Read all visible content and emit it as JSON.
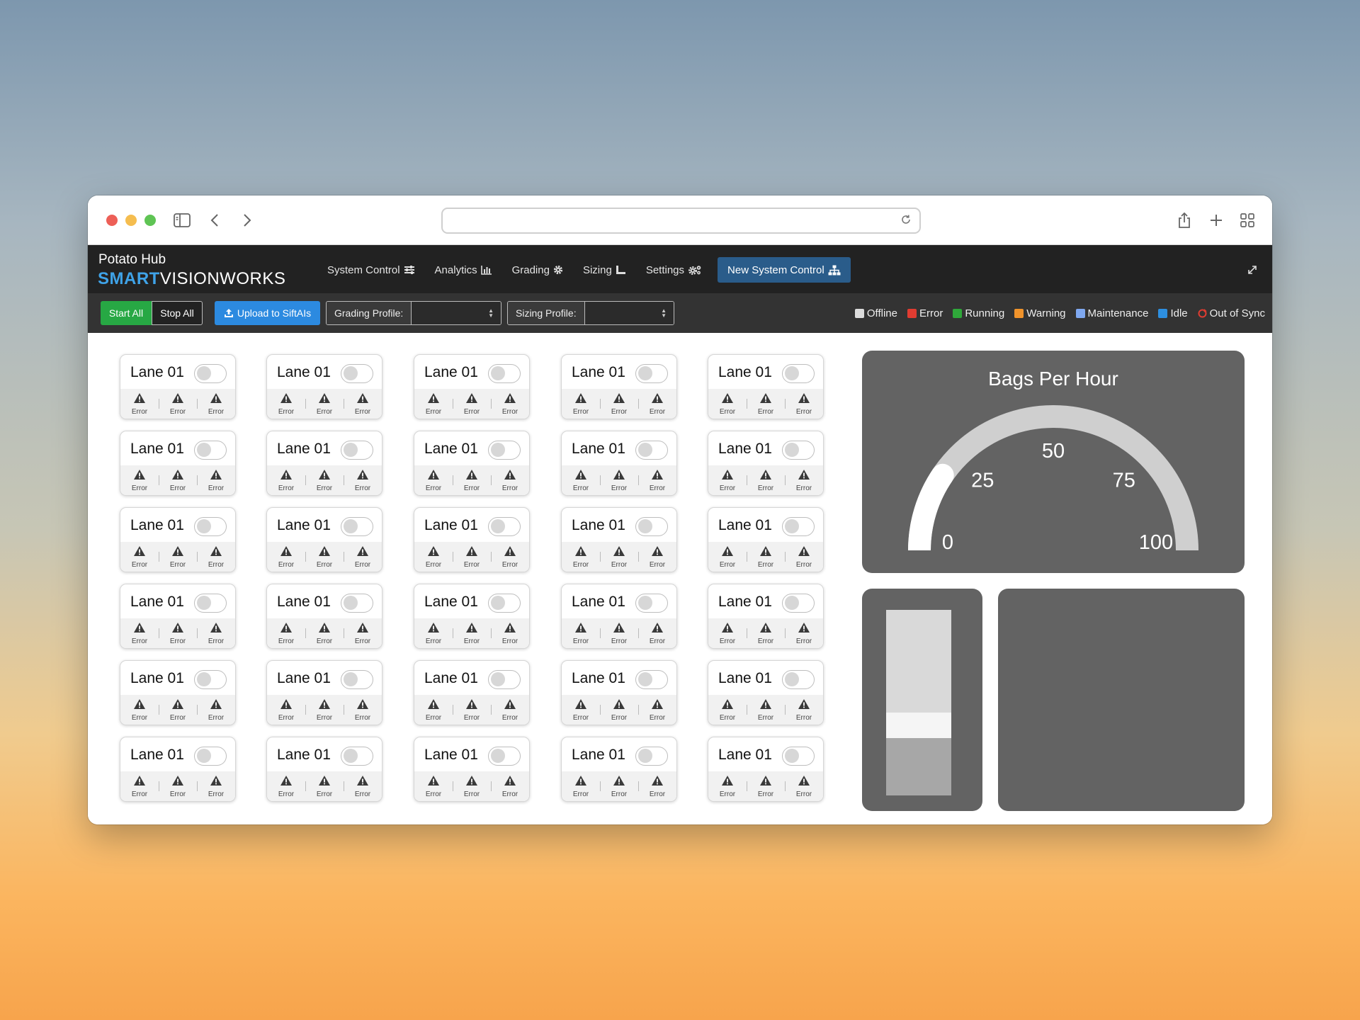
{
  "browser": {
    "address_value": ""
  },
  "app": {
    "brand_top": "Potato Hub",
    "brand_smart": "SMART",
    "brand_rest": "VISIONWORKS",
    "nav": [
      {
        "label": "System Control",
        "icon": "sliders-icon"
      },
      {
        "label": "Analytics",
        "icon": "bar-chart-icon"
      },
      {
        "label": "Grading",
        "icon": "gear-icon"
      },
      {
        "label": "Sizing",
        "icon": "ruler-icon"
      },
      {
        "label": "Settings",
        "icon": "gears-icon"
      },
      {
        "label": "New System Control",
        "icon": "sitemap-icon",
        "active": true
      }
    ]
  },
  "toolbar": {
    "start_all": "Start All",
    "stop_all": "Stop All",
    "upload": "Upload to SiftAIs",
    "grading_profile_label": "Grading Profile:",
    "grading_profile_value": "",
    "sizing_profile_label": "Sizing Profile:",
    "sizing_profile_value": ""
  },
  "legend": [
    {
      "label": "Offline",
      "color": "#dcdcdc"
    },
    {
      "label": "Error",
      "color": "#e03c31"
    },
    {
      "label": "Running",
      "color": "#2fa83a"
    },
    {
      "label": "Warning",
      "color": "#f0932b"
    },
    {
      "label": "Maintenance",
      "color": "#7fa8f0"
    },
    {
      "label": "Idle",
      "color": "#2d8fe0"
    },
    {
      "label": "Out of Sync",
      "color": "#e03c31",
      "icon": "sync-icon"
    }
  ],
  "lanes": {
    "name": "Lane 01",
    "status_label": "Error",
    "status_icon": "warning-icon",
    "toggle_on": false,
    "rows": 6,
    "cols": 5
  },
  "gauge": {
    "title": "Bags Per Hour",
    "min": 0,
    "max": 100,
    "value": 19,
    "ticks": [
      0,
      25,
      50,
      75,
      100
    ]
  },
  "level_bar": {
    "value_fraction": 0.31,
    "marker_fraction": 0.44
  }
}
